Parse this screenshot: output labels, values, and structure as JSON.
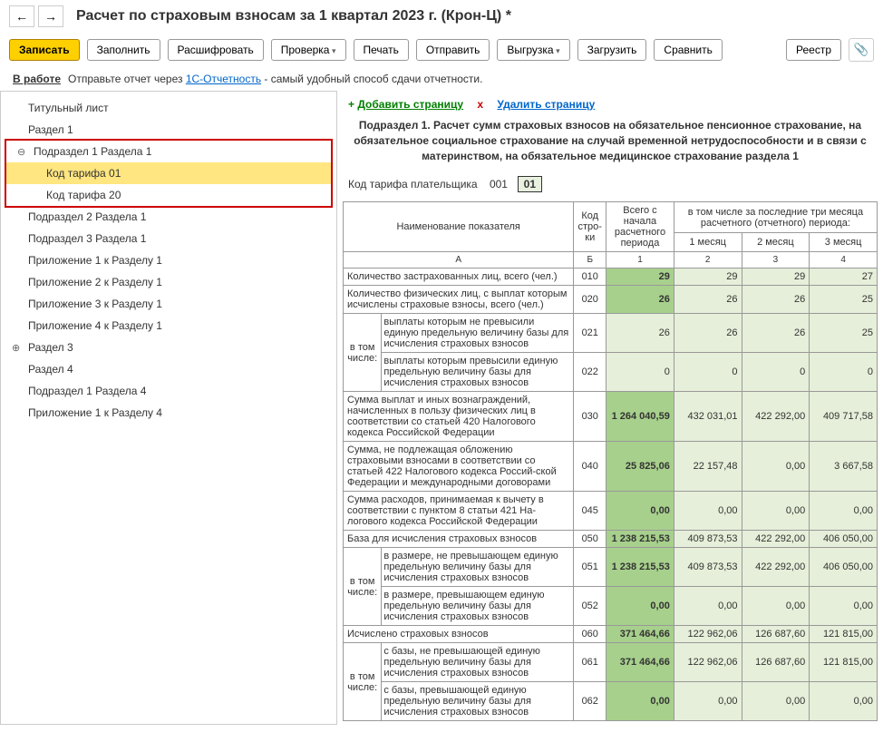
{
  "header": {
    "title": "Расчет по страховым взносам за 1 квартал 2023 г. (Крон-Ц) *"
  },
  "toolbar": {
    "write": "Записать",
    "fill": "Заполнить",
    "decrypt": "Расшифровать",
    "check": "Проверка",
    "print": "Печать",
    "send": "Отправить",
    "export": "Выгрузка",
    "import": "Загрузить",
    "compare": "Сравнить",
    "registry": "Реестр"
  },
  "status": {
    "label": "В работе",
    "text1": "Отправьте отчет через ",
    "link": "1С-Отчетность",
    "text2": " - самый удобный способ сдачи отчетности."
  },
  "tree": {
    "items": [
      "Титульный лист",
      "Раздел 1",
      "Подраздел 1 Раздела 1",
      "Код тарифа 01",
      "Код тарифа 20",
      "Подраздел 2 Раздела 1",
      "Подраздел 3 Раздела 1",
      "Приложение 1 к Разделу 1",
      "Приложение 2 к Разделу 1",
      "Приложение 3 к Разделу 1",
      "Приложение 4 к Разделу 1",
      "Раздел 3",
      "Раздел 4",
      "Подраздел 1 Раздела 4",
      "Приложение 1 к Разделу 4"
    ]
  },
  "pageActions": {
    "add": "Добавить страницу",
    "del": "Удалить страницу"
  },
  "section": {
    "title": "Подраздел 1. Расчет сумм страховых взносов на обязательное пенсионное страхование, на обязательное социальное страхование на случай временной нетрудоспособности и в связи с материнством, на обязательное медицинское страхование раздела 1",
    "tariffLabel": "Код тарифа плательщика",
    "tariffCode": "001",
    "tariffBox": "01"
  },
  "table": {
    "headers": {
      "name": "Наименование показателя",
      "code": "Код стро-ки",
      "total": "Всего с начала расчетного периода",
      "recent": "в том числе за последние три месяца расчетного (отчетного) периода:",
      "m1": "1 месяц",
      "m2": "2 месяц",
      "m3": "3 месяц",
      "colA": "А",
      "colB": "Б",
      "c1": "1",
      "c2": "2",
      "c3": "3",
      "c4": "4",
      "vtom": "в том числе:"
    },
    "rows": [
      {
        "name": "Количество застрахованных лиц, всего (чел.)",
        "code": "010",
        "v1": "29",
        "v2": "29",
        "v3": "29",
        "v4": "27",
        "strong": true
      },
      {
        "name": "Количество физических лиц, с выплат которым исчислены страховые взносы, всего (чел.)",
        "code": "020",
        "v1": "26",
        "v2": "26",
        "v3": "26",
        "v4": "25",
        "strong": true
      },
      {
        "name": "выплаты которым не превысили единую предельную величину базы для исчисления страховых взносов",
        "code": "021",
        "v1": "26",
        "v2": "26",
        "v3": "26",
        "v4": "25",
        "strong": false,
        "sub": true
      },
      {
        "name": "выплаты которым превысили единую предельную величину базы для исчисления страховых взносов",
        "code": "022",
        "v1": "0",
        "v2": "0",
        "v3": "0",
        "v4": "0",
        "strong": false,
        "sub": true
      },
      {
        "name": "Сумма выплат и иных вознаграждений, начисленных в пользу физических лиц в соответствии со статьей 420 Налогового кодекса Российской Федерации",
        "code": "030",
        "v1": "1 264 040,59",
        "v2": "432 031,01",
        "v3": "422 292,00",
        "v4": "409 717,58",
        "strong": true
      },
      {
        "name": "Сумма, не подлежащая обложению страховыми взносами в соответствии со статьей 422 Налогового кодекса Россий-ской  Федерации и международными договорами",
        "code": "040",
        "v1": "25 825,06",
        "v2": "22 157,48",
        "v3": "0,00",
        "v4": "3 667,58",
        "strong": true
      },
      {
        "name": "Сумма расходов, принимаемая к вычету в соответствии с пунктом 8 статьи 421 На-логового кодекса Российской Федерации",
        "code": "045",
        "v1": "0,00",
        "v2": "0,00",
        "v3": "0,00",
        "v4": "0,00",
        "strong": true
      },
      {
        "name": "База для исчисления страховых взносов",
        "code": "050",
        "v1": "1 238 215,53",
        "v2": "409 873,53",
        "v3": "422 292,00",
        "v4": "406 050,00",
        "strong": true
      },
      {
        "name": "в размере, не превышающем единую предельную величину базы для исчисления страховых взносов",
        "code": "051",
        "v1": "1 238 215,53",
        "v2": "409 873,53",
        "v3": "422 292,00",
        "v4": "406 050,00",
        "strong": true,
        "sub": true
      },
      {
        "name": "в размере, превышающем единую предельную величину базы для исчисления страховых взносов",
        "code": "052",
        "v1": "0,00",
        "v2": "0,00",
        "v3": "0,00",
        "v4": "0,00",
        "strong": true,
        "sub": true
      },
      {
        "name": "Исчислено страховых взносов",
        "code": "060",
        "v1": "371 464,66",
        "v2": "122 962,06",
        "v3": "126 687,60",
        "v4": "121 815,00",
        "strong": true
      },
      {
        "name": "с базы, не превышающей единую предельную величину базы для исчисления страховых взносов",
        "code": "061",
        "v1": "371 464,66",
        "v2": "122 962,06",
        "v3": "126 687,60",
        "v4": "121 815,00",
        "strong": true,
        "sub": true
      },
      {
        "name": "с базы, превышающей единую предельную величину базы для исчисления страховых взносов",
        "code": "062",
        "v1": "0,00",
        "v2": "0,00",
        "v3": "0,00",
        "v4": "0,00",
        "strong": true,
        "sub": true
      }
    ]
  }
}
